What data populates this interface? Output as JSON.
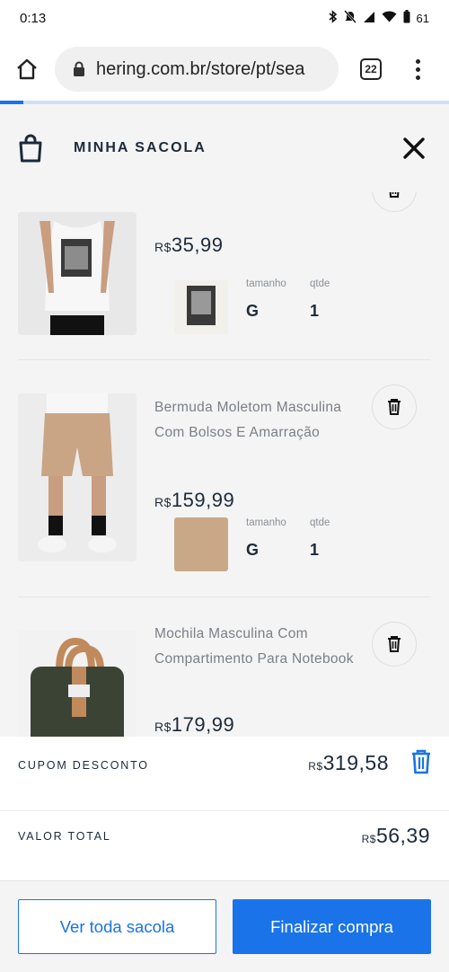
{
  "status": {
    "time": "0:13",
    "battery": "61"
  },
  "browser": {
    "url": "hering.com.br/store/pt/sea",
    "tab_count": "22"
  },
  "cart": {
    "title": "MINHA SACOLA"
  },
  "attr_labels": {
    "size": "tamanho",
    "qty": "qtde"
  },
  "currency": "R$",
  "items": [
    {
      "name_fragment": "' ",
      "price": "35,99",
      "size": "G",
      "qty": "1"
    },
    {
      "name": "Bermuda Moletom Masculina Com Bolsos E Amarração",
      "price": "159,99",
      "size": "G",
      "qty": "1"
    },
    {
      "name": "Mochila Masculina Com Compartimento Para Notebook",
      "price": "179,99"
    }
  ],
  "summary": {
    "coupon_label": "CUPOM DESCONTO",
    "coupon_value": "319,58",
    "total_label": "VALOR TOTAL",
    "total_value": "56,39"
  },
  "buttons": {
    "view_bag": "Ver toda sacola",
    "checkout": "Finalizar compra"
  },
  "colors": {
    "accent": "#1a73e8",
    "navy": "#1c2a3a",
    "swatch_tan": "#c8a886"
  },
  "icons": [
    "bluetooth-icon",
    "mute-icon",
    "signal-icon",
    "wifi-icon",
    "battery-icon",
    "home-icon",
    "lock-icon",
    "shopping-bag-icon",
    "close-icon",
    "trash-icon"
  ]
}
